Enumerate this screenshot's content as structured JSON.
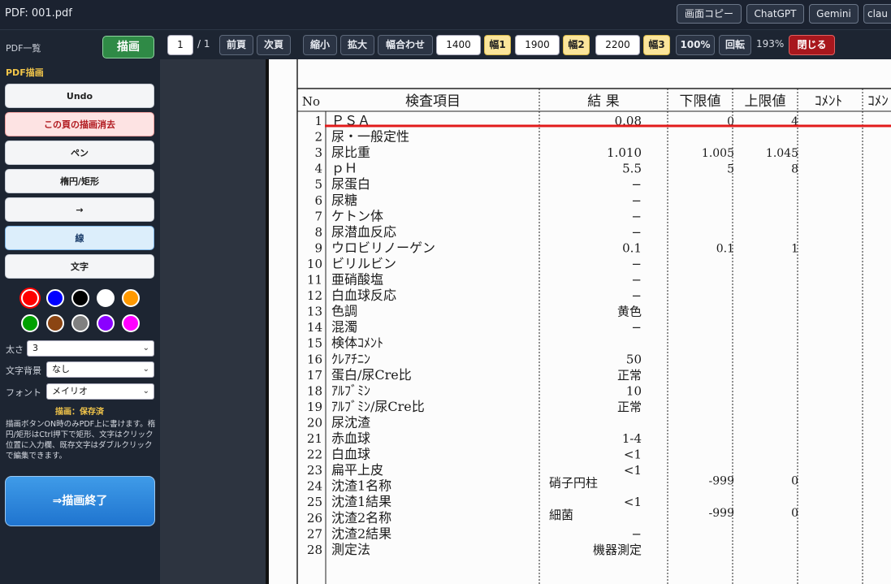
{
  "window": {
    "title": "PDF: 001.pdf"
  },
  "top_buttons": [
    {
      "label": "画面コピー"
    },
    {
      "label": "ChatGPT"
    },
    {
      "label": "Gemini"
    },
    {
      "label": "clau"
    }
  ],
  "sidebar": {
    "pdf_list_label": "PDF一覧",
    "draw_button": "描画",
    "section_title": "PDF描画",
    "tools": [
      {
        "label": "Undo"
      },
      {
        "label": "この頁の描画消去"
      },
      {
        "label": "ペン"
      },
      {
        "label": "楕円/矩形"
      },
      {
        "label": "→"
      },
      {
        "label": "線"
      },
      {
        "label": "文字"
      }
    ],
    "colors": [
      "#ff0000",
      "#0000ff",
      "#000000",
      "#ffffff",
      "#ff9900",
      "#00a000",
      "#8b4513",
      "#808080",
      "#8a00ff",
      "#ff00ff"
    ],
    "thickness": {
      "label": "太さ",
      "value": "3"
    },
    "text_bg": {
      "label": "文字背景",
      "value": "なし"
    },
    "font": {
      "label": "フォント",
      "value": "メイリオ"
    },
    "save_status": "描画：保存済",
    "help_text": "描画ボタンON時のみPDF上に書けます。楕円/矩形はCtrl押下で矩形、文字はクリック位置に入力欄、既存文字はダブルクリックで編集できます。",
    "end_button": "⇒描画終了"
  },
  "toolbar": {
    "page_current": "1",
    "page_sep": "/ 1",
    "prev": "前頁",
    "next": "次頁",
    "zoom_out": "縮小",
    "zoom_in": "拡大",
    "fit_width": "幅合わせ",
    "w1_value": "1400",
    "w1_label": "幅1",
    "w2_value": "1900",
    "w2_label": "幅2",
    "w3_value": "2200",
    "w3_label": "幅3",
    "zoom100": "100%",
    "rotate": "回転",
    "zoom_level": "193%",
    "close": "閉じる"
  },
  "document": {
    "headers": [
      "No",
      "検査項目",
      "結 果",
      "下限値",
      "上限値",
      "ｺﾒﾝﾄ",
      "ｺﾒﾝ"
    ],
    "rows": [
      {
        "no": "1",
        "item": "ＰＳＡ",
        "result": "0.08",
        "low": "0",
        "high": "4"
      },
      {
        "no": "2",
        "item": "尿・一般定性",
        "result": "",
        "low": "",
        "high": ""
      },
      {
        "no": "3",
        "item": "尿比重",
        "result": "1.010",
        "low": "1.005",
        "high": "1.045"
      },
      {
        "no": "4",
        "item": "ｐＨ",
        "result": "5.5",
        "low": "5",
        "high": "8"
      },
      {
        "no": "5",
        "item": "尿蛋白",
        "result": "−",
        "low": "",
        "high": ""
      },
      {
        "no": "6",
        "item": "尿糖",
        "result": "−",
        "low": "",
        "high": ""
      },
      {
        "no": "7",
        "item": "ケトン体",
        "result": "−",
        "low": "",
        "high": ""
      },
      {
        "no": "8",
        "item": "尿潜血反応",
        "result": "−",
        "low": "",
        "high": ""
      },
      {
        "no": "9",
        "item": "ウロビリノーゲン",
        "result": "0.1",
        "low": "0.1",
        "high": "1"
      },
      {
        "no": "10",
        "item": "ビリルビン",
        "result": "−",
        "low": "",
        "high": ""
      },
      {
        "no": "11",
        "item": "亜硝酸塩",
        "result": "−",
        "low": "",
        "high": ""
      },
      {
        "no": "12",
        "item": "白血球反応",
        "result": "−",
        "low": "",
        "high": ""
      },
      {
        "no": "13",
        "item": "色調",
        "result": "黄色",
        "low": "",
        "high": ""
      },
      {
        "no": "14",
        "item": "混濁",
        "result": "−",
        "low": "",
        "high": ""
      },
      {
        "no": "15",
        "item": "検体ｺﾒﾝﾄ",
        "result": "",
        "low": "",
        "high": ""
      },
      {
        "no": "16",
        "item": "ｸﾚｱﾁﾆﾝ",
        "result": "50",
        "low": "",
        "high": ""
      },
      {
        "no": "17",
        "item": "蛋白/尿Cre比",
        "result": "正常",
        "low": "",
        "high": ""
      },
      {
        "no": "18",
        "item": "ｱﾙﾌﾞﾐﾝ",
        "result": "10",
        "low": "",
        "high": ""
      },
      {
        "no": "19",
        "item": "ｱﾙﾌﾞﾐﾝ/尿Cre比",
        "result": "正常",
        "low": "",
        "high": ""
      },
      {
        "no": "20",
        "item": "尿沈渣",
        "result": "",
        "low": "",
        "high": ""
      },
      {
        "no": "21",
        "item": "赤血球",
        "result": "1-4",
        "low": "",
        "high": ""
      },
      {
        "no": "22",
        "item": "白血球",
        "result": "<1",
        "low": "",
        "high": ""
      },
      {
        "no": "23",
        "item": "扁平上皮",
        "result": "<1",
        "low": "",
        "high": ""
      },
      {
        "no": "24",
        "item": "沈渣1名称",
        "result": "硝子円柱",
        "result_align": "left",
        "low": "-999",
        "high": "0"
      },
      {
        "no": "25",
        "item": "沈渣1結果",
        "result": "<1",
        "low": "",
        "high": ""
      },
      {
        "no": "26",
        "item": "沈渣2名称",
        "result": "細菌",
        "result_align": "left",
        "low": "-999",
        "high": "0"
      },
      {
        "no": "27",
        "item": "沈渣2結果",
        "result": "−",
        "low": "",
        "high": ""
      },
      {
        "no": "28",
        "item": "測定法",
        "result": "機器測定",
        "low": "",
        "high": ""
      }
    ]
  }
}
